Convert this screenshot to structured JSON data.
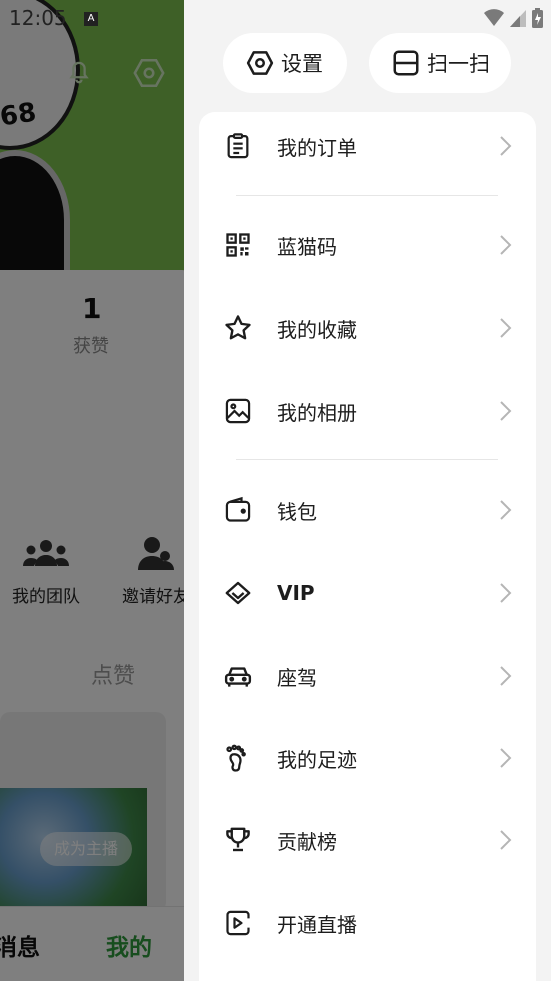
{
  "status_bar": {
    "time": "12:05",
    "notification_badge": "A"
  },
  "background_page": {
    "avatar_number": "68",
    "likes_count": "1",
    "likes_label": "获赞",
    "team_label": "我的团队",
    "invite_label": "邀请好友",
    "likes_tab": "点赞",
    "become_anchor": "成为主播",
    "nav_messages": "消息",
    "nav_mine": "我的",
    "accent_color": "#2f9b3c"
  },
  "drawer": {
    "settings_label": "设置",
    "scan_label": "扫一扫",
    "items": [
      {
        "label": "我的订单",
        "icon": "order-list-icon"
      },
      {
        "label": "蓝猫码",
        "icon": "qr-code-icon"
      },
      {
        "label": "我的收藏",
        "icon": "star-icon"
      },
      {
        "label": "我的相册",
        "icon": "photo-album-icon"
      },
      {
        "label": "钱包",
        "icon": "wallet-icon"
      },
      {
        "label": "VIP",
        "icon": "diamond-icon"
      },
      {
        "label": "座驾",
        "icon": "car-icon"
      },
      {
        "label": "我的足迹",
        "icon": "footprint-icon"
      },
      {
        "label": "贡献榜",
        "icon": "trophy-icon"
      },
      {
        "label": "开通直播",
        "icon": "live-stream-icon"
      }
    ]
  }
}
